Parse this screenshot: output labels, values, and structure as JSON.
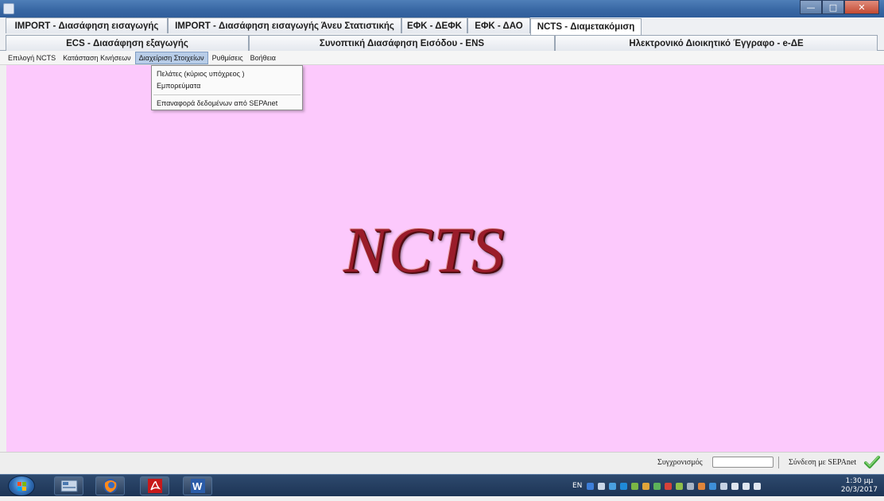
{
  "window": {
    "app_icon": "java-app-icon",
    "minimize_glyph": "—",
    "maximize_glyph": "□",
    "close_glyph": "✕"
  },
  "tabs_row1": [
    {
      "label": "IMPORT - Διασάφηση εισαγωγής",
      "active": false
    },
    {
      "label": "IMPORT - Διασάφηση εισαγωγής Άνευ Στατιστικής",
      "active": false
    },
    {
      "label": "ΕΦΚ - ΔΕΦΚ",
      "active": false
    },
    {
      "label": "ΕΦΚ - ΔΑΟ",
      "active": false
    },
    {
      "label": "NCTS - Διαμετακόμιση",
      "active": true
    }
  ],
  "tabs_row2": [
    {
      "label": "ECS - Διασάφηση εξαγωγής"
    },
    {
      "label": "Συνοπτική Διασάφηση Εισόδου - ENS"
    },
    {
      "label": "Ηλεκτρονικό Διοικητικό Έγγραφο - e-ΔΕ"
    }
  ],
  "menu": [
    {
      "label": "Επιλογή NCTS"
    },
    {
      "label": "Κατάσταση Κινήσεων"
    },
    {
      "label": "Διαχείριση Στοιχείων",
      "open": true
    },
    {
      "label": "Ρυθμίσεις"
    },
    {
      "label": "Βοήθεια"
    }
  ],
  "dropdown": {
    "items": [
      {
        "label": "Πελάτες (κύριος υπόχρεος )"
      },
      {
        "label": "Εμπορεύματα"
      },
      {
        "label": "Επαναφορά δεδομένων από SEPAnet"
      }
    ]
  },
  "content": {
    "logo_text": "NCTS",
    "background": "#fcc9fc"
  },
  "statusbar": {
    "sync_label": "Συγχρονισμός",
    "connection_label": "Σύνδεση με SEPAnet",
    "connection_status": "connected"
  },
  "taskbar": {
    "apps": [
      "windows-start-icon",
      "sepa-app-icon",
      "firefox-icon",
      "acrobat-icon",
      "word-icon"
    ],
    "language": "EN",
    "clock_time": "1:30 μμ",
    "clock_date": "20/3/2017"
  }
}
